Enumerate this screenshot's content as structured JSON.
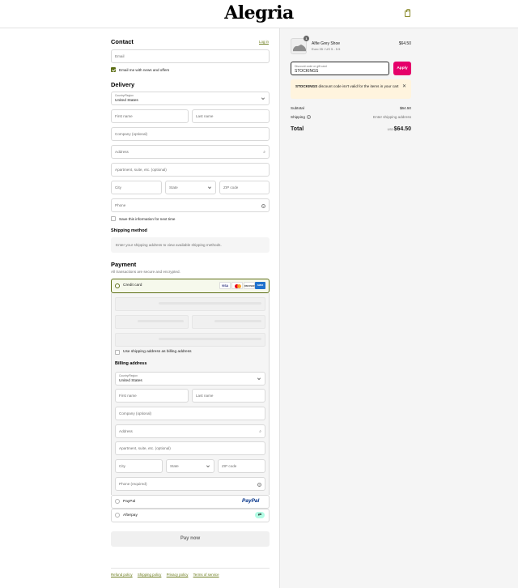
{
  "header": {
    "logo": "Alegria",
    "cart_icon": "shopping-bag-icon"
  },
  "contact": {
    "title": "Contact",
    "login_link": "Log in",
    "email_placeholder": "Email",
    "newsletter_label": "Email me with news and offers",
    "newsletter_checked": true
  },
  "delivery": {
    "title": "Delivery",
    "country_label": "Country/Region",
    "country_value": "United States",
    "first_name": "First name",
    "last_name": "Last name",
    "company": "Company (optional)",
    "address": "Address",
    "apartment": "Apartment, suite, etc. (optional)",
    "city": "City",
    "state": "State",
    "zip": "ZIP code",
    "phone": "Phone",
    "save_info_label": "Save this information for next time"
  },
  "shipping": {
    "title": "Shipping method",
    "message": "Enter your shipping address to view available shipping methods."
  },
  "payment": {
    "title": "Payment",
    "subtitle": "All transactions are secure and encrypted.",
    "credit_card_label": "Credit card",
    "card_brands": [
      "VISA",
      "MC",
      "DISCOVER",
      "AMEX"
    ],
    "use_shipping_label": "Use shipping address as billing address",
    "billing_title": "Billing address",
    "billing": {
      "country_label": "Country/Region",
      "country_value": "United States",
      "first_name": "First name",
      "last_name": "Last name",
      "company": "Company (optional)",
      "address": "Address",
      "apartment": "Apartment, suite, etc. (optional)",
      "city": "City",
      "state": "State",
      "zip": "ZIP code",
      "phone": "Phone (required)"
    },
    "paypal_label": "PayPal",
    "paypal_logo": "PayPal",
    "afterpay_label": "Afterpay",
    "pay_now": "Pay now"
  },
  "footer": {
    "links": [
      "Refund policy",
      "Shipping policy",
      "Privacy policy",
      "Terms of service"
    ]
  },
  "summary": {
    "item": {
      "quantity": "1",
      "name": "Alfie Grey Shoe",
      "variant": "Euro 35 / US 5 - 5.5",
      "price": "$64.50"
    },
    "discount": {
      "label": "Discount code or gift card",
      "value": "STOCKINGS",
      "apply": "Apply"
    },
    "warning": {
      "code": "STOCKINGS",
      "message": " discount code isn't valid for the items in your cart"
    },
    "subtotal_label": "Subtotal",
    "subtotal_value": "$64.50",
    "shipping_label": "Shipping",
    "shipping_value": "Enter shipping address",
    "total_label": "Total",
    "currency": "USD",
    "total_value": "$64.50"
  },
  "colors": {
    "accent": "#5c6e15",
    "apply_button": "#e5006a",
    "warning_bg": "#fff4de"
  }
}
